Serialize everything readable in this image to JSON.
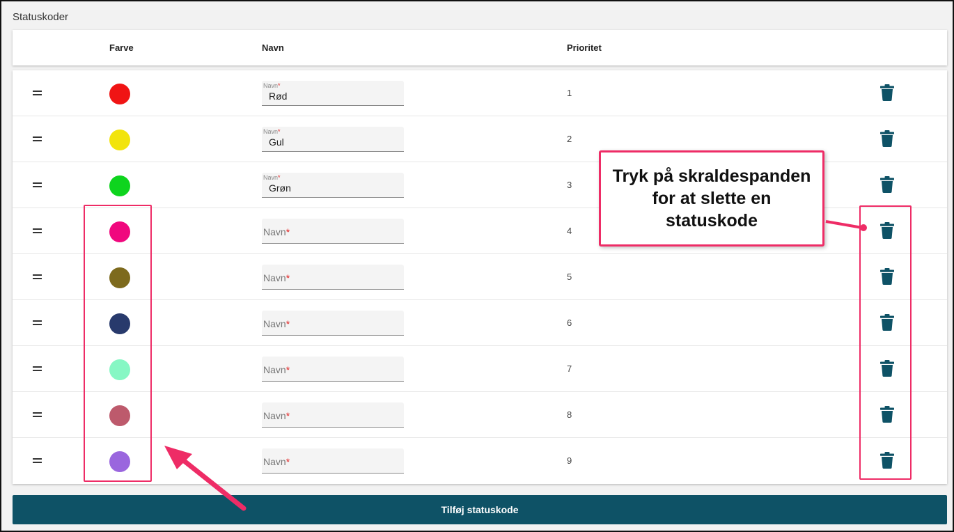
{
  "section_title": "Statuskoder",
  "columns": {
    "farve": "Farve",
    "navn": "Navn",
    "prioritet": "Prioritet"
  },
  "field_label": "Navn",
  "required_mark": "*",
  "rows": [
    {
      "color": "#f01414",
      "name": "Rød",
      "priority": "1"
    },
    {
      "color": "#f2e40c",
      "name": "Gul",
      "priority": "2"
    },
    {
      "color": "#0ed41e",
      "name": "Grøn",
      "priority": "3"
    },
    {
      "color": "#f0087e",
      "name": "",
      "priority": "4"
    },
    {
      "color": "#7d6a1d",
      "name": "",
      "priority": "5"
    },
    {
      "color": "#283a6c",
      "name": "",
      "priority": "6"
    },
    {
      "color": "#86f7c4",
      "name": "",
      "priority": "7"
    },
    {
      "color": "#bd5a6c",
      "name": "",
      "priority": "8"
    },
    {
      "color": "#9a66de",
      "name": "",
      "priority": "9"
    }
  ],
  "add_button": "Tilføj statuskode",
  "callout_text": "Tryk på skraldespanden for at slette en statuskode",
  "accent_colors": {
    "primary": "#0e5266",
    "annotation": "#ee2c66",
    "trash": "#0e5266"
  }
}
